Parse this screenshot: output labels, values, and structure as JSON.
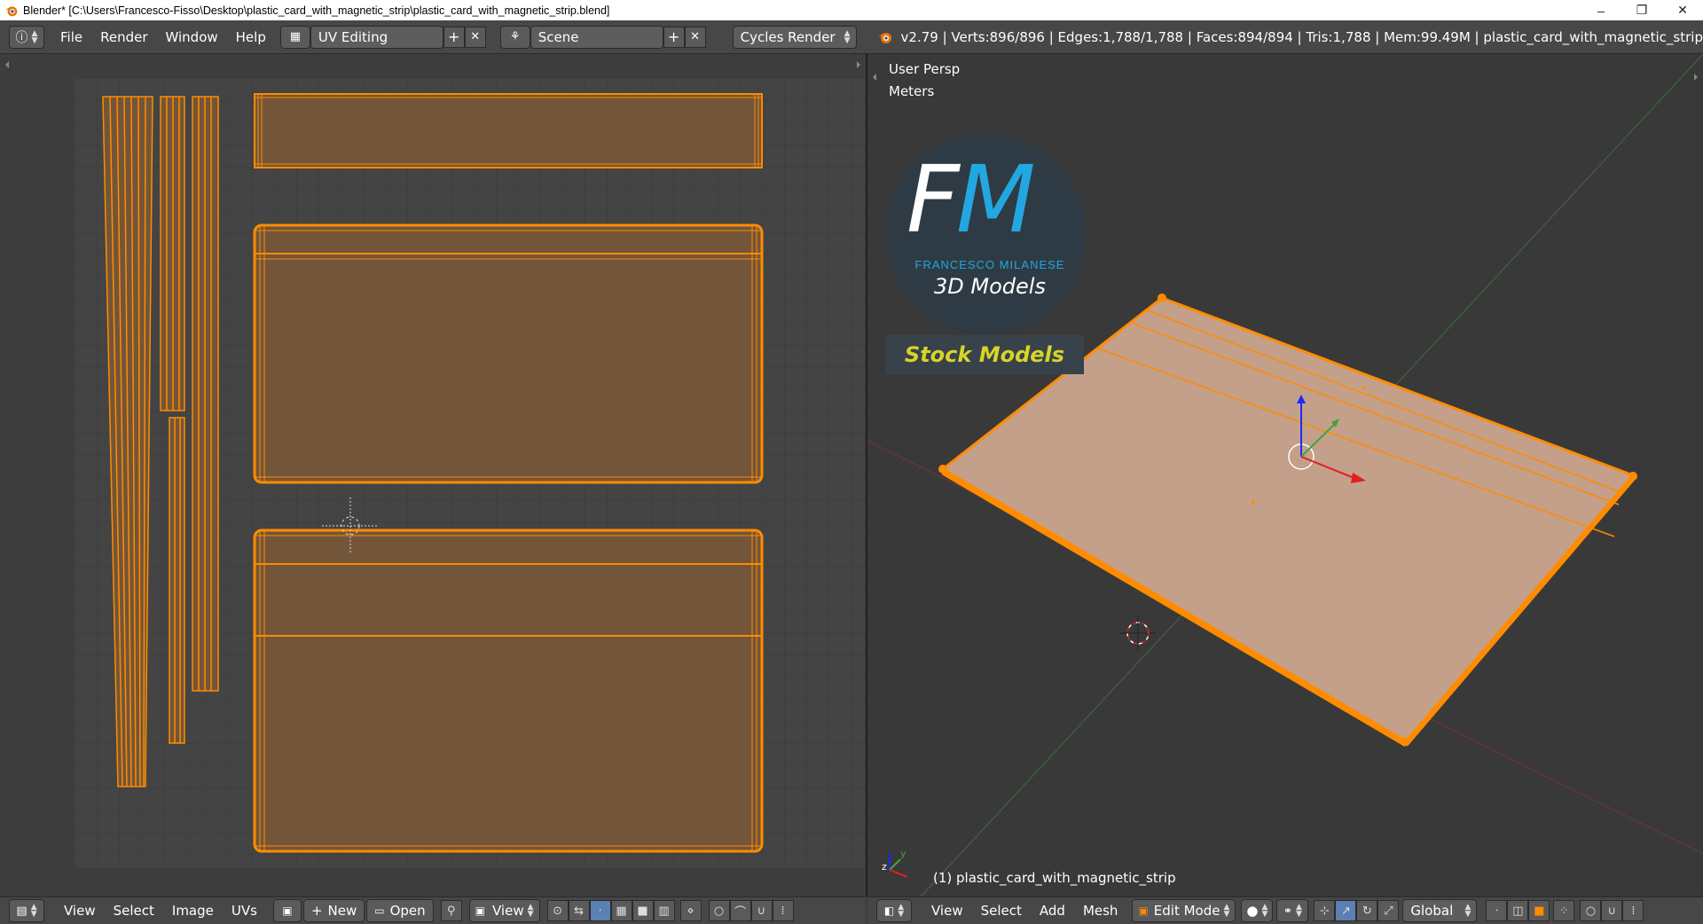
{
  "window": {
    "title": "Blender* [C:\\Users\\Francesco-Fisso\\Desktop\\plastic_card_with_magnetic_strip\\plastic_card_with_magnetic_strip.blend]",
    "minimize": "–",
    "maximize": "❐",
    "close": "✕"
  },
  "topbar": {
    "menus": [
      "File",
      "Render",
      "Window",
      "Help"
    ],
    "screen_layout": "UV Editing",
    "scene": "Scene",
    "render_engine": "Cycles Render",
    "stats": "v2.79 | Verts:896/896 | Edges:1,788/1,788 | Faces:894/894 | Tris:1,788 | Mem:99.49M | plastic_card_with_magnetic_strip"
  },
  "uv_editor": {
    "menus": [
      "View",
      "Select",
      "Image",
      "UVs"
    ],
    "new_label": "New",
    "open_label": "Open",
    "view_label": "View"
  },
  "view3d": {
    "view_name": "User Persp",
    "units": "Meters",
    "object_label": "(1) plastic_card_with_magnetic_strip",
    "menus": [
      "View",
      "Select",
      "Add",
      "Mesh"
    ],
    "mode": "Edit Mode",
    "orientation": "Global",
    "watermark": {
      "letters_f": "F",
      "letters_m": "M",
      "author": "FRANCESCO MILANESE",
      "subtitle": "3D Models",
      "banner": "Stock Models"
    }
  },
  "colors": {
    "accent_orange": "#ff8c00",
    "uv_face_fill": "#735539",
    "selection_blue": "#5b80b2"
  }
}
